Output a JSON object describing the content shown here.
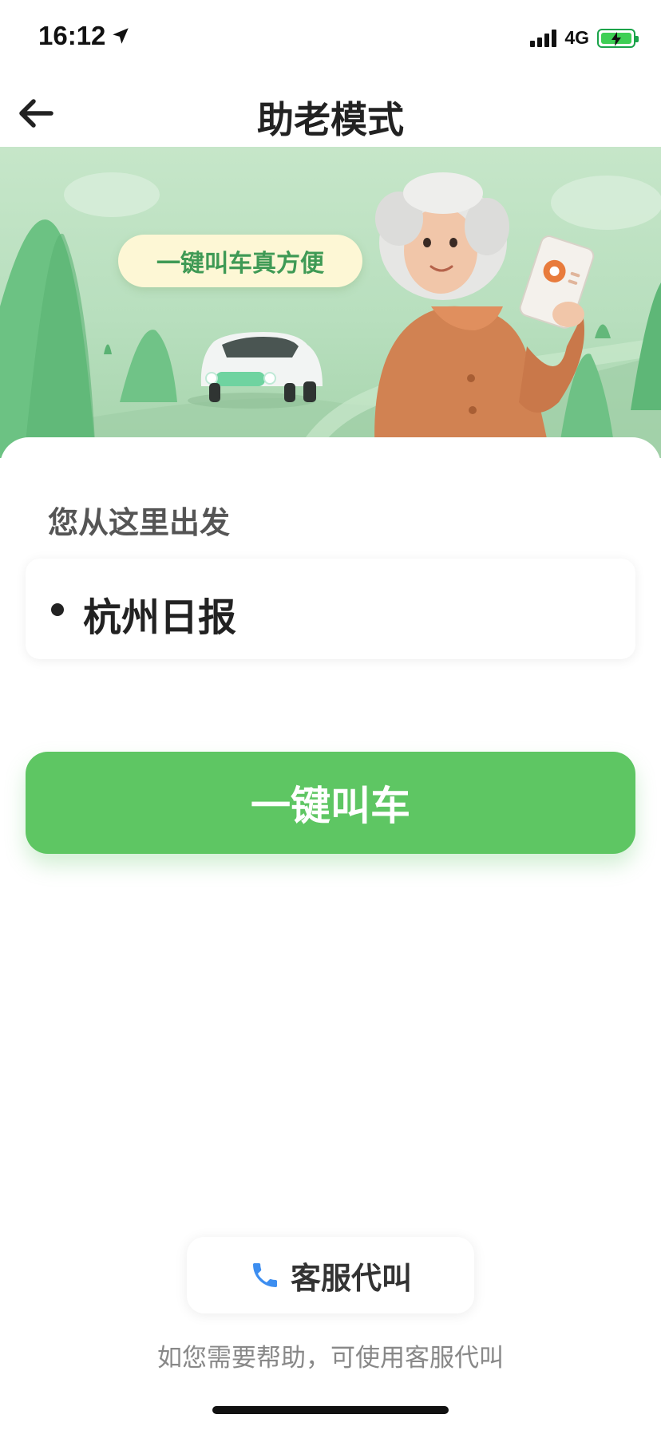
{
  "status_bar": {
    "time": "16:12",
    "network": "4G",
    "icons": [
      "location-arrow-icon",
      "signal-bars-icon",
      "battery-charging-icon"
    ]
  },
  "nav": {
    "back_icon": "arrow-left-icon",
    "title": "助老模式"
  },
  "banner": {
    "bubble_text": "一键叫车真方便"
  },
  "origin": {
    "heading": "您从这里出发",
    "location": "杭州日报"
  },
  "actions": {
    "call_car_label": "一键叫车",
    "service_label": "客服代叫",
    "service_icon": "phone-icon"
  },
  "footer": {
    "help_text": "如您需要帮助，可使用客服代叫"
  },
  "colors": {
    "primary_green": "#5ec663",
    "banner_green": "#b8dfbe",
    "phone_blue": "#3d8ef0"
  }
}
